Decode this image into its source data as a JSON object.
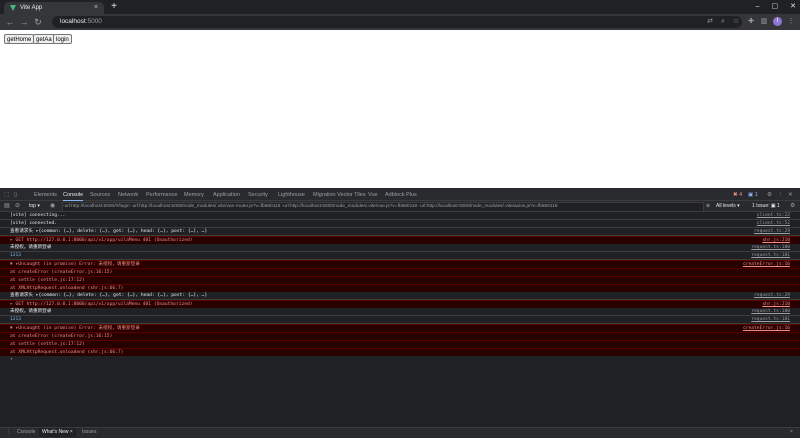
{
  "browser": {
    "tab_title": "Vite App",
    "tab_close": "×",
    "new_tab": "+",
    "window_controls": [
      "–",
      "▢",
      "✕"
    ],
    "url_host": "localhost",
    "url_port": ":5000",
    "profile_initial": "I"
  },
  "page": {
    "buttons": [
      "getHome",
      "getAa",
      "login"
    ]
  },
  "devtools": {
    "tabs": [
      "Elements",
      "Console",
      "Sources",
      "Network",
      "Performance",
      "Memory",
      "Application",
      "Security",
      "Lighthouse",
      "Migration Vector Tiles",
      "Vue",
      "Adblock Plus"
    ],
    "badges": {
      "errors": "4",
      "messages": "1"
    },
    "top_selector": "top ▾",
    "filter_text": "-url:http://localhost:5000/#/login -url:http://localhost:5000/node_modules/.vite/vue-router.js?v=fb660118 -url:http://localhost:5000/node_modules/.vite/vue.js?v=fb660118 -url:http://localhost:5000/node_modules/.vite/axios.js?v=fb660118",
    "levels": "All levels ▾",
    "issues": "1 Issue: ▣ 1"
  },
  "console": [
    {
      "kind": "log",
      "text": "[vite] connecting...",
      "src": "client.ts:22"
    },
    {
      "kind": "log",
      "text": "[vite] connected.",
      "src": "client.ts:52"
    },
    {
      "kind": "log",
      "text": "查看请求头  ▸{common: {…}, delete: {…}, get: {…}, head: {…}, post: {…}, …}",
      "src": "request.ts:29"
    },
    {
      "kind": "err",
      "text": "▸ GET http://127.0.0.1:8000/api/v1/app/uilaMenu 401 (Unauthorized)",
      "src": "xhr.js:210"
    },
    {
      "kind": "log",
      "text": "未授权，请重新登录",
      "src": "request.ts:100"
    },
    {
      "kind": "log-blue",
      "text": "1213",
      "src": "request.ts:101"
    },
    {
      "kind": "err",
      "text": "✖ ▸Uncaught (in promise) Error: 未授权，请重新登录",
      "src": "createError.js:16"
    },
    {
      "kind": "err",
      "text": "      at createError (createError.js:16:15)",
      "src": ""
    },
    {
      "kind": "err",
      "text": "      at settle (settle.js:17:12)",
      "src": ""
    },
    {
      "kind": "err",
      "text": "      at XMLHttpRequest.onloadend (xhr.js:66:7)",
      "src": ""
    },
    {
      "kind": "log",
      "text": "查看请求头  ▸{common: {…}, delete: {…}, get: {…}, head: {…}, post: {…}, …}",
      "src": "request.ts:29"
    },
    {
      "kind": "err",
      "text": "▸ GET http://127.0.0.1:8000/api/v1/app/uilaMenu 401 (Unauthorized)",
      "src": "xhr.js:210"
    },
    {
      "kind": "log",
      "text": "未授权，请重新登录",
      "src": "request.ts:100"
    },
    {
      "kind": "log-blue",
      "text": "1213",
      "src": "request.ts:101"
    },
    {
      "kind": "err",
      "text": "✖ ▸Uncaught (in promise) Error: 未授权，请重新登录",
      "src": "createError.js:16"
    },
    {
      "kind": "err",
      "text": "      at createError (createError.js:16:15)",
      "src": ""
    },
    {
      "kind": "err",
      "text": "      at settle (settle.js:17:12)",
      "src": ""
    },
    {
      "kind": "err",
      "text": "      at XMLHttpRequest.onloadend (xhr.js:66:7)",
      "src": ""
    },
    {
      "kind": "prompt",
      "text": "›",
      "src": ""
    }
  ],
  "drawer": {
    "tabs": [
      "Console",
      "What's New ×",
      "Issues"
    ],
    "close": "×"
  },
  "colors": {
    "error_bg": "#290000",
    "error_text": "#f28b82",
    "link_blue": "#8ab4f8",
    "devtools_bg": "#202124"
  }
}
